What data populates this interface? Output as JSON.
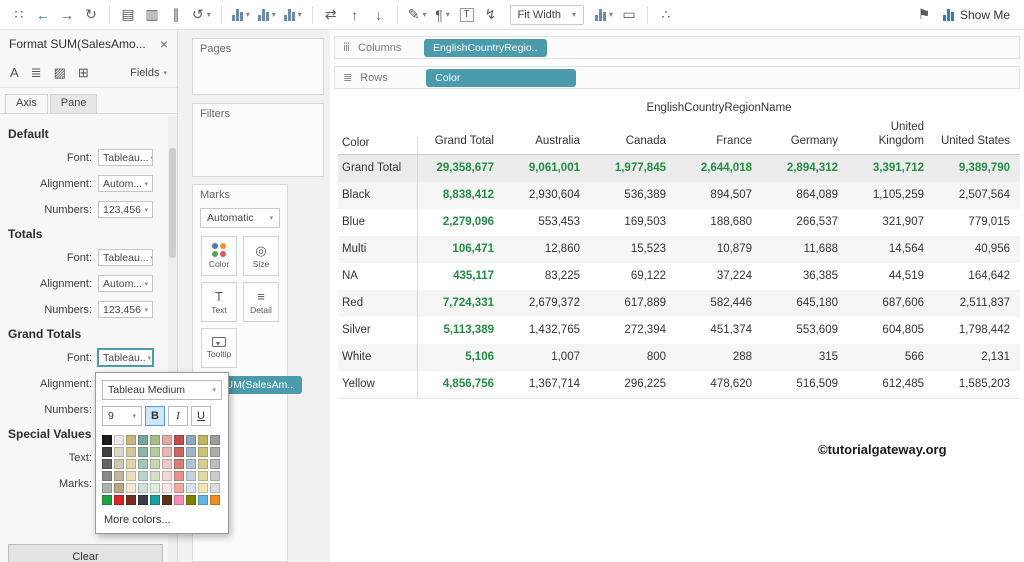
{
  "toolbar": {
    "items": [
      {
        "kind": "icon",
        "name": "tableau-logo-icon",
        "glyph": "∷"
      },
      {
        "kind": "icon",
        "name": "back-icon",
        "glyph": "←",
        "color": "#2a79af"
      },
      {
        "kind": "icon",
        "name": "forward-icon",
        "glyph": "→"
      },
      {
        "kind": "icon",
        "name": "redo-icon",
        "glyph": "↻"
      },
      {
        "kind": "sep"
      },
      {
        "kind": "icon",
        "name": "save-icon",
        "glyph": "▤"
      },
      {
        "kind": "icon",
        "name": "new-datasource-icon",
        "glyph": "▥"
      },
      {
        "kind": "icon",
        "name": "pause-updates-icon",
        "glyph": "∥"
      },
      {
        "kind": "icon",
        "name": "refresh-icon",
        "glyph": "↺",
        "caret": true
      },
      {
        "kind": "sep"
      },
      {
        "kind": "bars",
        "name": "new-worksheet-icon",
        "caret": true
      },
      {
        "kind": "bars",
        "name": "duplicate-sheet-icon",
        "caret": true
      },
      {
        "kind": "bars",
        "name": "clear-sheet-icon",
        "caret": true
      },
      {
        "kind": "sep"
      },
      {
        "kind": "icon",
        "name": "swap-axes-icon",
        "glyph": "⇄"
      },
      {
        "kind": "icon",
        "name": "sort-ascending-icon",
        "glyph": "↑"
      },
      {
        "kind": "icon",
        "name": "sort-descending-icon",
        "glyph": "↓"
      },
      {
        "kind": "sep"
      },
      {
        "kind": "icon",
        "name": "highlighter-icon",
        "glyph": "✎",
        "caret": true
      },
      {
        "kind": "icon",
        "name": "annotation-icon",
        "glyph": "¶",
        "caret": true
      },
      {
        "kind": "icon",
        "name": "text-label-icon",
        "glyph": "T",
        "boxed": true
      },
      {
        "kind": "icon",
        "name": "lightning-icon",
        "glyph": "↯"
      },
      {
        "kind": "select",
        "name": "fit-width-select",
        "label": "Fit Width",
        "caret": true
      },
      {
        "kind": "bars",
        "name": "view-cards-icon",
        "caret": true
      },
      {
        "kind": "icon",
        "name": "presentation-icon",
        "glyph": "▭"
      },
      {
        "kind": "sep"
      },
      {
        "kind": "icon",
        "name": "share-icon",
        "glyph": "∴"
      },
      {
        "kind": "space"
      },
      {
        "kind": "icon",
        "name": "pin-icon",
        "glyph": "⚑"
      },
      {
        "kind": "showme",
        "name": "show-me-button",
        "label": "Show Me"
      }
    ]
  },
  "format_pane": {
    "title": "Format SUM(SalesAmo...",
    "close": "×",
    "icons": {
      "font": "A",
      "alignment": "≣",
      "shading": "▨",
      "borders": "⊞"
    },
    "fields_label": "Fields",
    "tabs": [
      {
        "label": "Axis",
        "active": true
      },
      {
        "label": "Pane",
        "active": false
      }
    ],
    "sections": {
      "default": {
        "heading": "Default",
        "font_label": "Font:",
        "font_value": "Tableau...",
        "alignment_label": "Alignment:",
        "alignment_value": "Autom...",
        "numbers_label": "Numbers:",
        "numbers_value": "123,456"
      },
      "totals": {
        "heading": "Totals",
        "font_label": "Font:",
        "font_value": "Tableau...",
        "alignment_label": "Alignment:",
        "alignment_value": "Autom...",
        "numbers_label": "Numbers:",
        "numbers_value": "123,456"
      },
      "grand_totals": {
        "heading": "Grand Totals",
        "font_label": "Font:",
        "font_value": "Tableau..",
        "alignment_label": "Alignment:",
        "numbers_label": "Numbers:"
      },
      "special_values": {
        "heading": "Special Values",
        "text_label": "Text:",
        "marks_label": "Marks:"
      }
    },
    "clear_button": "Clear"
  },
  "font_popup": {
    "font_name": "Tableau Medium",
    "size": "9",
    "bold": "B",
    "italic": "I",
    "underline": "U",
    "more_colors": "More colors...",
    "palette": [
      [
        "#1c1c1c",
        "#e9e9e9",
        "#c9b783",
        "#76a79e",
        "#a4c08a",
        "#e2a8a4",
        "#c0504d",
        "#8fa8bd",
        "#c0b65f",
        "#9e9e9e"
      ],
      [
        "#3f3f3f",
        "#dcd6c8",
        "#d6c79a",
        "#8fb5ad",
        "#b4cc9e",
        "#e8b8b4",
        "#cd6762",
        "#a0b5c8",
        "#ccc275",
        "#adadad"
      ],
      [
        "#636363",
        "#d0c7b2",
        "#e0d2ac",
        "#a5c4bd",
        "#c3d7b2",
        "#eec8c4",
        "#d97d77",
        "#b2c4d4",
        "#d8cd8b",
        "#bcbcbc"
      ],
      [
        "#8a8a8a",
        "#c4b89c",
        "#eaddc0",
        "#bcd3cc",
        "#d2e2c6",
        "#f4d8d4",
        "#e5938c",
        "#c4d3e0",
        "#e4d9a2",
        "#cccccc"
      ],
      [
        "#b0b0b0",
        "#b8a986",
        "#f4e8d4",
        "#d2e2db",
        "#e1edda",
        "#fae8e4",
        "#f1a9a1",
        "#d6e2ec",
        "#f0e4b8",
        "#dcdcdc"
      ],
      [
        "#24a044",
        "#d62728",
        "#7b2a22",
        "#3a3f4a",
        "#1b9e9e",
        "#5c3317",
        "#f48fb1",
        "#808000",
        "#62b6de",
        "#ef8d22"
      ]
    ]
  },
  "cards": {
    "pages_title": "Pages",
    "filters_title": "Filters",
    "marks": {
      "title": "Marks",
      "mark_type": "Automatic",
      "buttons": [
        {
          "label": "Color"
        },
        {
          "label": "Size"
        },
        {
          "label": "Text"
        },
        {
          "label": "Detail"
        },
        {
          "label": "Tooltip"
        }
      ],
      "size_glyph": "◎",
      "text_glyph": "T",
      "detail_glyph": "≡",
      "pill_icon": "T",
      "pill": "SUM(SalesAm.."
    }
  },
  "shelves": {
    "columns_label": "Columns",
    "columns_icon": "ⅲ",
    "columns_pill": "EnglishCountryRegio..",
    "rows_label": "Rows",
    "rows_icon": "≣",
    "rows_pill": "Color"
  },
  "table": {
    "spanning_header": "EnglishCountryRegionName",
    "corner_label": "Color",
    "columns": [
      "Grand Total",
      "Australia",
      "Canada",
      "France",
      "Germany",
      "United Kingdom",
      "United States"
    ],
    "rows": [
      {
        "label": "Grand Total",
        "grand": true,
        "values": [
          "29,358,677",
          "9,061,001",
          "1,977,845",
          "2,644,018",
          "2,894,312",
          "3,391,712",
          "9,389,790"
        ]
      },
      {
        "label": "Black",
        "values": [
          "8,838,412",
          "2,930,604",
          "536,389",
          "894,507",
          "864,089",
          "1,105,259",
          "2,507,564"
        ]
      },
      {
        "label": "Blue",
        "values": [
          "2,279,096",
          "553,453",
          "169,503",
          "188,680",
          "266,537",
          "321,907",
          "779,015"
        ]
      },
      {
        "label": "Multi",
        "values": [
          "106,471",
          "12,860",
          "15,523",
          "10,879",
          "11,688",
          "14,564",
          "40,956"
        ]
      },
      {
        "label": "NA",
        "values": [
          "435,117",
          "83,225",
          "69,122",
          "37,224",
          "36,385",
          "44,519",
          "164,642"
        ]
      },
      {
        "label": "Red",
        "values": [
          "7,724,331",
          "2,679,372",
          "617,889",
          "582,446",
          "645,180",
          "687,606",
          "2,511,837"
        ]
      },
      {
        "label": "Silver",
        "values": [
          "5,113,389",
          "1,432,765",
          "272,394",
          "451,374",
          "553,609",
          "604,805",
          "1,798,442"
        ]
      },
      {
        "label": "White",
        "values": [
          "5,106",
          "1,007",
          "800",
          "288",
          "315",
          "566",
          "2,131"
        ]
      },
      {
        "label": "Yellow",
        "values": [
          "4,856,756",
          "1,367,714",
          "296,225",
          "478,620",
          "516,509",
          "612,485",
          "1,585,203"
        ]
      }
    ]
  },
  "watermark": "©tutorialgateway.org",
  "colors": {
    "pill": "#4a9bab",
    "grand_total_text": "#238b45",
    "accent_blue": "#2a79af"
  }
}
